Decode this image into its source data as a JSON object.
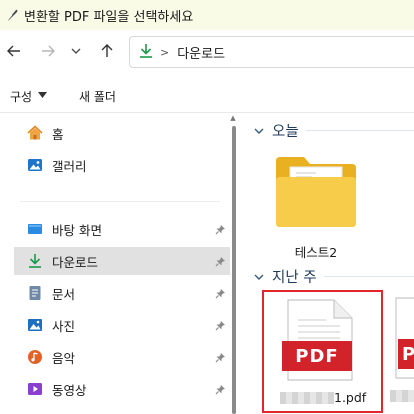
{
  "window": {
    "title": "변환할 PDF 파일을 선택하세요",
    "icon": "feather-pen-icon"
  },
  "navigation": {
    "back": "arrow-left-icon",
    "forward": "arrow-right-icon",
    "recent": "chevron-down-icon",
    "up": "arrow-up-icon",
    "address": {
      "icon": "download-icon",
      "crumbs": [
        "다운로드"
      ]
    }
  },
  "command_bar": {
    "organize_label": "구성",
    "new_folder_label": "새 폴더"
  },
  "sidebar": {
    "top_items": [
      {
        "label": "홈",
        "icon": "home-icon"
      },
      {
        "label": "갤러리",
        "icon": "gallery-icon"
      }
    ],
    "pinned_items": [
      {
        "label": "바탕 화면",
        "icon": "desktop-icon",
        "pinned": true
      },
      {
        "label": "다운로드",
        "icon": "download-icon",
        "pinned": true,
        "selected": true
      },
      {
        "label": "문서",
        "icon": "documents-icon",
        "pinned": true
      },
      {
        "label": "사진",
        "icon": "pictures-icon",
        "pinned": true
      },
      {
        "label": "음악",
        "icon": "music-icon",
        "pinned": true
      },
      {
        "label": "동영상",
        "icon": "videos-icon",
        "pinned": true
      }
    ]
  },
  "content": {
    "groups": [
      {
        "title": "오늘",
        "items": [
          {
            "name": "테스트2",
            "type": "folder"
          }
        ]
      },
      {
        "title": "지난 주",
        "items": [
          {
            "name": "1.pdf",
            "type": "pdf",
            "badge": "PDF",
            "selected": true,
            "name_obscured_prefix": true
          },
          {
            "name": "",
            "type": "pdf",
            "badge": "PDF",
            "partial": true
          }
        ]
      }
    ]
  },
  "colors": {
    "title_bar_bg": "#fafbe6",
    "accent_green": "#1a9a4a",
    "pdf_red": "#d3232a",
    "highlight_border": "#e2262c",
    "selected_sidebar_bg": "#e1e1e1"
  }
}
